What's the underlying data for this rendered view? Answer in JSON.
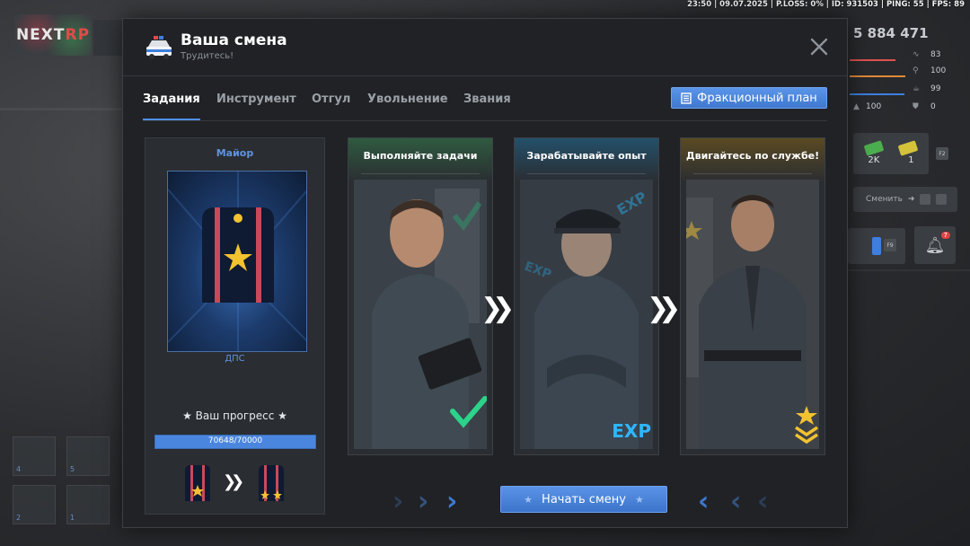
{
  "hud": {
    "status_line": "23:50 | 09.07.2025 | P.LOSS: 0% | ID: 931503 | PING: 55 | FPS: 89",
    "logo_text": "NEXT",
    "logo_accent": "RP",
    "money": "5 884 471",
    "stats": [
      {
        "value": "83",
        "icon": "activity-icon",
        "color": "#e05050",
        "fill": 0.83
      },
      {
        "value": "100",
        "icon": "food-icon",
        "color": "#e08a3a",
        "fill": 1.0
      },
      {
        "value": "99",
        "icon": "water-icon",
        "color": "#3f7fe0",
        "fill": 0.99
      },
      {
        "value": "0",
        "icon": "armor-icon",
        "color": "#8a8e93",
        "fill": 0.0
      }
    ],
    "stat_left": "100",
    "cash_count": "2K",
    "bill_count": "1",
    "change_label": "Сменить",
    "key_f2": "F2",
    "key_f9": "F9",
    "notif_count": "7",
    "slots": [
      "4",
      "5",
      "2",
      "1"
    ]
  },
  "modal": {
    "title": "Ваша смена",
    "subtitle": "Трудитесь!",
    "tabs": [
      "Задания",
      "Инструмент",
      "Отгул",
      "Увольнение",
      "Звания"
    ],
    "active_tab": 0,
    "plan_button": "Фракционный план"
  },
  "rank": {
    "title": "Майор",
    "department": "ДПС",
    "progress_label": "★ Ваш прогресс ★",
    "progress_text": "70648/70000",
    "progress_fraction": 1.0
  },
  "steps": [
    {
      "title": "Выполняйте задачи",
      "accent": "#3a8a5a",
      "badge": "check-icon"
    },
    {
      "title": "Зарабатывайте опыт",
      "accent": "#2f7fa0",
      "badge": "exp-badge",
      "badge_text": "EXP"
    },
    {
      "title": "Двигайтесь по службе!",
      "accent": "#9a7a2a",
      "badge": "rank-chevrons-icon"
    }
  ],
  "start_button": "Начать смену",
  "colors": {
    "accent_blue": "#4f8fe6",
    "panel": "#202226",
    "card": "#2a2d31",
    "gold": "#f2c230",
    "stripe_red": "#c84a5a"
  }
}
